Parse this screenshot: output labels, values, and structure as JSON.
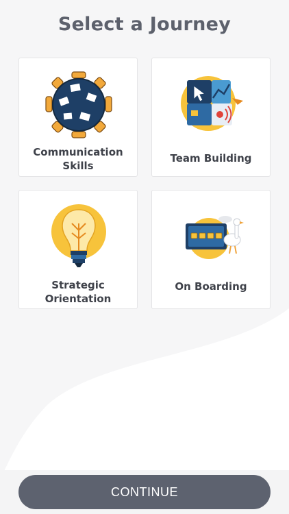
{
  "header": {
    "title": "Select a Journey"
  },
  "journeys": [
    {
      "label": "Communication Skills",
      "icon": "round-table-icon"
    },
    {
      "label": "Team Building",
      "icon": "puzzle-pieces-icon"
    },
    {
      "label": "Strategic Orientation",
      "icon": "light-bulb-icon"
    },
    {
      "label": "On Boarding",
      "icon": "onboarding-board-icon"
    }
  ],
  "footer": {
    "continue_label": "CONTINUE"
  },
  "colors": {
    "accent": "#5d626f",
    "title": "#5d616c",
    "yellow": "#f7c33b",
    "navy": "#1e3f66"
  }
}
